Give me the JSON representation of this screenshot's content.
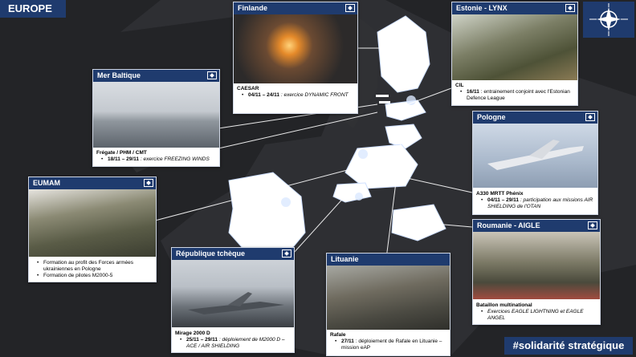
{
  "header": {
    "region": "EUROPE"
  },
  "hashtag": "#solidarité stratégique",
  "colors": {
    "navy": "#1f3b6e",
    "map_land": "#2f3033",
    "highlight": "#ffffff",
    "background": "#202124"
  },
  "cards": {
    "finlande": {
      "title": "Finlande",
      "caption": "CAESAR",
      "items": [
        {
          "dates": "04/11 – 24/11",
          "text": " : exercice DYNAMIC FRONT"
        }
      ]
    },
    "estonie": {
      "title": "Estonie - LYNX",
      "caption": "CIL",
      "items": [
        {
          "dates": "16/11",
          "text": " : entrainement conjoint avec l'Estonian Defence League"
        }
      ]
    },
    "mer_baltique": {
      "title": "Mer Baltique",
      "caption": "Frégate / PHM / CMT",
      "items": [
        {
          "dates": "18/11 – 29/11",
          "text": " : exercice FREEZING WINDS"
        }
      ]
    },
    "pologne": {
      "title": "Pologne",
      "caption": "A330 MRTT Phénix",
      "items": [
        {
          "dates": "04/11 – 29/11",
          "text": " : participation aux missions AIR SHIELDING de l'OTAN"
        }
      ]
    },
    "eumam": {
      "title": "EUMAM",
      "caption": "",
      "items": [
        {
          "dates": "",
          "text": "Formation au profit des Forces armées ukrainiennes en Pologne"
        },
        {
          "dates": "",
          "text": "Formation de pilotes M2000-5"
        }
      ]
    },
    "roumanie": {
      "title": "Roumanie - AIGLE",
      "caption": "Bataillon multinational",
      "items": [
        {
          "dates": "",
          "text": "Exercices EAGLE LIGHTNING et EAGLE ANGEL"
        }
      ]
    },
    "rep_tcheque": {
      "title": "République tchèque",
      "caption": "Mirage 2000 D",
      "items": [
        {
          "dates": "25/11 – 29/11",
          "text": " : déploiement de M2000 D – ACE / AIR SHIELDING"
        }
      ]
    },
    "lituanie": {
      "title": "Lituanie",
      "caption": "Rafale",
      "items": [
        {
          "dates": "27/11",
          "text": " : déploiement de Rafale en Lituanie – mission eAP"
        }
      ]
    }
  }
}
